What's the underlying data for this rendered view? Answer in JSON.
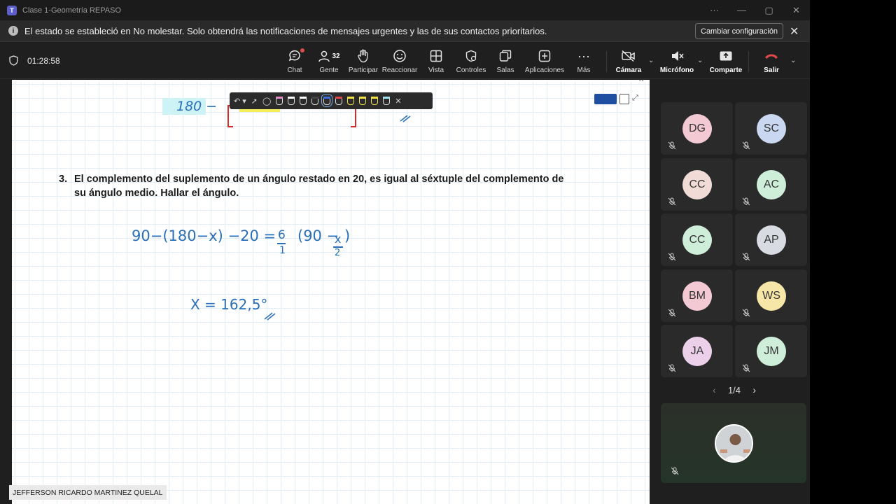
{
  "window": {
    "title": "Clase 1-Geometría REPASO",
    "controls": [
      "···",
      "—",
      "▢",
      "✕"
    ]
  },
  "notification": {
    "message": "El estado se estableció en No molestar. Solo obtendrá las notificaciones de mensajes urgentes y las de sus contactos prioritarios.",
    "button": "Cambiar configuración"
  },
  "toolbar": {
    "timer": "01:28:58",
    "people_count": "32",
    "buttons": {
      "chat": "Chat",
      "gente": "Gente",
      "participar": "Participar",
      "reaccionar": "Reaccionar",
      "vista": "Vista",
      "controles": "Controles",
      "salas": "Salas",
      "aplicaciones": "Aplicaciones",
      "mas": "Más",
      "camara": "Cámara",
      "microfono": "Micrófono",
      "comparte": "Comparte",
      "salir": "Salir"
    }
  },
  "whiteboard": {
    "problem_number": "3.",
    "problem_text": "El complemento del suplemento de un ángulo restado en 20, es igual al séxtuple del complemento de su ángulo medio. Hallar el ángulo.",
    "top_fragment": "180 −",
    "equation_left": "90−(180−x) −20 =",
    "equation_frac1_num": "6",
    "equation_frac1_den": "1",
    "equation_right_open": "(90 −",
    "equation_frac2_num": "x",
    "equation_frac2_den": "2",
    "equation_right_close": ")",
    "answer": "X = 162,5°"
  },
  "participants": [
    {
      "initials": "DG",
      "color": "#f3c9d4"
    },
    {
      "initials": "SC",
      "color": "#c9d8f0"
    },
    {
      "initials": "CC",
      "color": "#f0dbd6"
    },
    {
      "initials": "AC",
      "color": "#cfeed9"
    },
    {
      "initials": "CC",
      "color": "#cfeed9"
    },
    {
      "initials": "AP",
      "color": "#d8dce2"
    },
    {
      "initials": "BM",
      "color": "#f3c9d4"
    },
    {
      "initials": "WS",
      "color": "#f6e6a8"
    },
    {
      "initials": "JA",
      "color": "#ecd0ea"
    },
    {
      "initials": "JM",
      "color": "#cfeed9"
    }
  ],
  "pager": {
    "label": "1/4"
  },
  "presenter": {
    "name": "JEFFERSON RICARDO MARTINEZ QUELAL"
  }
}
